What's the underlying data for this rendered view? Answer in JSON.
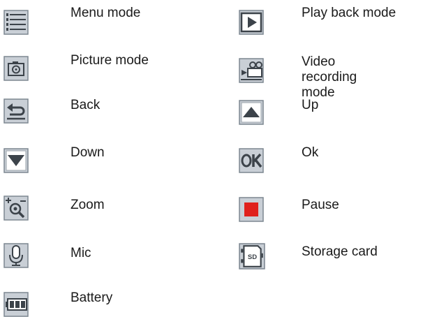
{
  "icon_legend": {
    "left_column": [
      {
        "icon": "menu-icon",
        "label": "Menu mode"
      },
      {
        "icon": "camera-icon",
        "label": "Picture mode"
      },
      {
        "icon": "back-arrow-icon",
        "label": "Back"
      },
      {
        "icon": "down-arrow-icon",
        "label": "Down"
      },
      {
        "icon": "zoom-icon",
        "label": "Zoom"
      },
      {
        "icon": "microphone-icon",
        "label": "Mic"
      },
      {
        "icon": "battery-icon",
        "label": "Battery"
      }
    ],
    "right_column": [
      {
        "icon": "playback-icon",
        "label": "Play back mode"
      },
      {
        "icon": "video-camera-icon",
        "label": "Video\nrecording mode"
      },
      {
        "icon": "up-arrow-icon",
        "label": "Up"
      },
      {
        "icon": "ok-icon",
        "label": "Ok"
      },
      {
        "icon": "stop-square-icon",
        "label": "Pause"
      },
      {
        "icon": "sd-card-icon",
        "label": "Storage card"
      }
    ],
    "colors": {
      "icon_background": "#c9cfd6",
      "icon_border": "#7d8791",
      "icon_glyph": "#3c434a",
      "pause_red": "#e0201c"
    }
  }
}
